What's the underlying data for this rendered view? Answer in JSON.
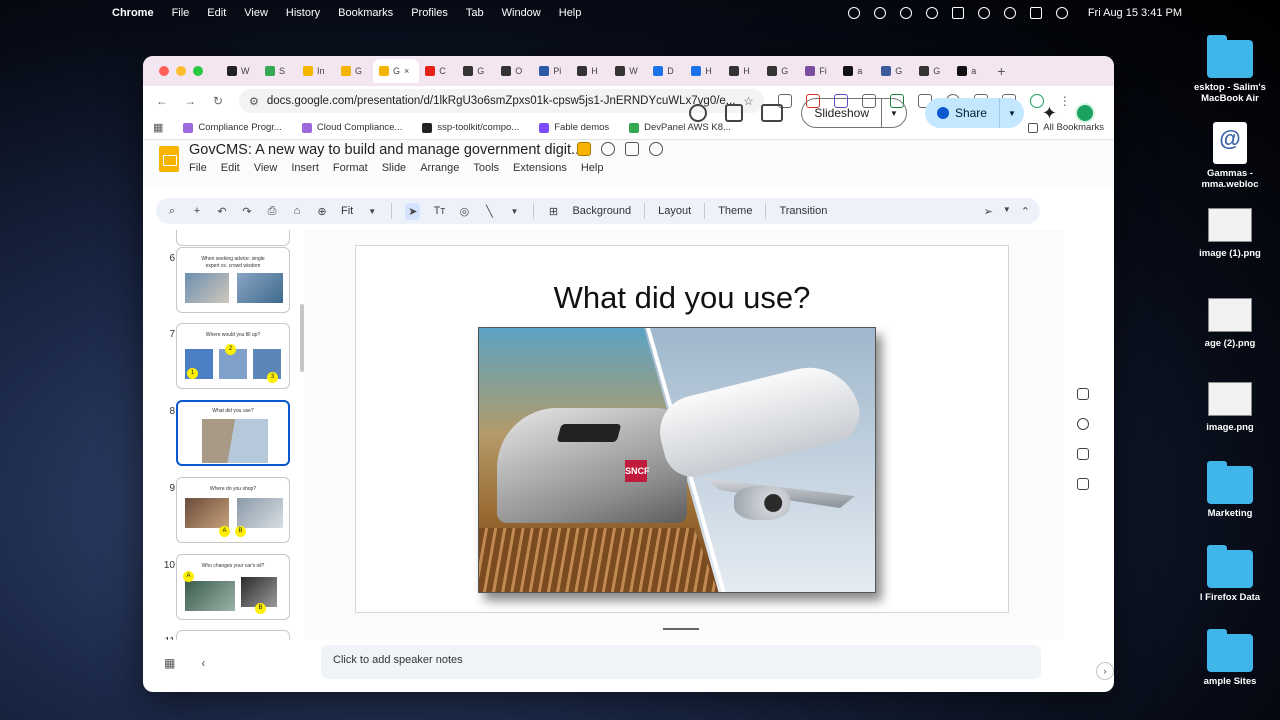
{
  "menubar": {
    "app": "Chrome",
    "items": [
      "File",
      "Edit",
      "View",
      "History",
      "Bookmarks",
      "Profiles",
      "Tab",
      "Window",
      "Help"
    ],
    "clock": "Fri Aug 15  3:41 PM"
  },
  "desktop_icons": [
    {
      "label": "esktop - Salim's MacBook Air",
      "kind": "folder"
    },
    {
      "label": "Gammas - mma.webloc",
      "kind": "webloc",
      "glyph": "@",
      "sub": "HTTP"
    },
    {
      "label": "image (1).png",
      "kind": "image"
    },
    {
      "label": "age (2).png",
      "kind": "image"
    },
    {
      "label": "image.png",
      "kind": "image"
    },
    {
      "label": "Marketing",
      "kind": "folder"
    },
    {
      "label": "l Firefox Data",
      "kind": "folder"
    },
    {
      "label": "ample Sites",
      "kind": "folder"
    }
  ],
  "tabs": [
    {
      "label": "W",
      "color": "#222222"
    },
    {
      "label": "S",
      "color": "#34a853"
    },
    {
      "label": "In",
      "color": "#f4b400"
    },
    {
      "label": "G",
      "color": "#f4b400"
    },
    {
      "label": "G",
      "color": "#f4b400",
      "active": true
    },
    {
      "label": "C",
      "color": "#e62117"
    },
    {
      "label": "G",
      "color": "#333333"
    },
    {
      "label": "O",
      "color": "#333333"
    },
    {
      "label": "Pi",
      "color": "#2d5ba8"
    },
    {
      "label": "H",
      "color": "#333333"
    },
    {
      "label": "W",
      "color": "#333333"
    },
    {
      "label": "D",
      "color": "#1a73e8"
    },
    {
      "label": "H",
      "color": "#1a73e8"
    },
    {
      "label": "H",
      "color": "#333333"
    },
    {
      "label": "G",
      "color": "#333333"
    },
    {
      "label": "Fi",
      "color": "#7b4fa0"
    },
    {
      "label": "a",
      "color": "#111111"
    },
    {
      "label": "G",
      "color": "#3c5a99"
    },
    {
      "label": "G",
      "color": "#333333"
    },
    {
      "label": "a",
      "color": "#111111"
    }
  ],
  "address": {
    "url": "docs.google.com/presentation/d/1lkRgU3o6smZpxs01k-cpsw5js1-JnERNDYcuWLx7vg0/e..."
  },
  "bookmarks": [
    {
      "label": "Compliance Progr...",
      "color": "#9c6ade"
    },
    {
      "label": "Cloud Compliance...",
      "color": "#9c6ade"
    },
    {
      "label": "ssp-toolkit/compo...",
      "color": "#222222"
    },
    {
      "label": "Fable demos",
      "color": "#7c4dff"
    },
    {
      "label": "DevPanel AWS K8...",
      "color": "#34a853"
    }
  ],
  "all_bookmarks": "All Bookmarks",
  "doc": {
    "title": "GovCMS: A new way to build and manage government digit...",
    "menu": [
      "File",
      "Edit",
      "View",
      "Insert",
      "Format",
      "Slide",
      "Arrange",
      "Tools",
      "Extensions",
      "Help"
    ],
    "slideshow": "Slideshow",
    "share": "Share"
  },
  "toolbar": {
    "zoom": "Fit",
    "background": "Background",
    "layout": "Layout",
    "theme": "Theme",
    "transition": "Transition"
  },
  "filmstrip": [
    {
      "num": "6",
      "title": "When seeking advice: single expert vs. crowd wisdom"
    },
    {
      "num": "7",
      "title": "Where would you fill up?",
      "dots": [
        "1",
        "2",
        "3"
      ]
    },
    {
      "num": "8",
      "title": "What did you use?",
      "selected": true
    },
    {
      "num": "9",
      "title": "Where do you shop?",
      "dots": [
        "A",
        "B"
      ]
    },
    {
      "num": "10",
      "title": "Who changes your car's oil?",
      "dots": [
        "A",
        "B"
      ]
    },
    {
      "num": "11",
      "title": ""
    }
  ],
  "slide": {
    "title": "What did you use?"
  },
  "photo_labels": {
    "train_logo": "SNCF"
  },
  "notes": {
    "placeholder": "Click to add speaker notes"
  }
}
